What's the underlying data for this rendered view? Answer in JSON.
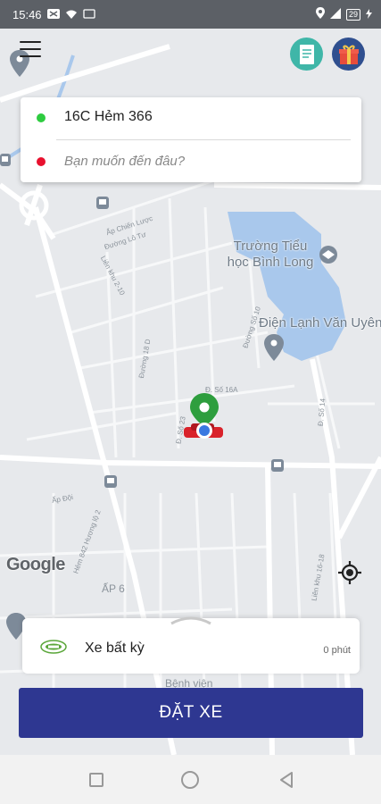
{
  "status_bar": {
    "time": "15:46",
    "battery": "29"
  },
  "search": {
    "pickup": "16C Hẻm 366",
    "destination_placeholder": "Bạn muốn đến đâu?"
  },
  "map": {
    "places": [
      {
        "name": "Trường Tiểu học Bình Long"
      },
      {
        "name": "Điện Lạnh Văn Uyên"
      }
    ],
    "street_labels": [
      "Ấp Chiến Lược",
      "Đường Lô Tư",
      "Liên khu 2-10",
      "Đường Số 10",
      "Đường 18 D",
      "Đ. Số 16A",
      "Đ. Số 14",
      "Đ. Số 23",
      "Ấp Đội",
      "Hẻm 842 Hương lộ 2",
      "ẤP 6",
      "Liên khu 16-18",
      "Bệnh viện"
    ],
    "attribution": "Google",
    "colors": {
      "water": "#a9c8ec",
      "road": "#ffffff",
      "background": "#e7e9ec",
      "pin": "#2e9e3e",
      "user_dot": "#3a78e0"
    }
  },
  "vehicle_selector": {
    "name": "Xe bất kỳ",
    "eta": "0 phút"
  },
  "actions": {
    "book": "ĐẶT XE"
  },
  "buttons": {
    "history_color": "#3fb6a8",
    "gift_color": "#2f4f8f"
  }
}
